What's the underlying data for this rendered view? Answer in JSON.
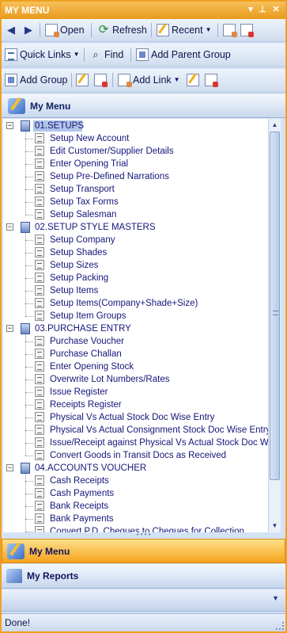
{
  "window": {
    "title": "MY MENU"
  },
  "toolbar1": {
    "open_label": "Open",
    "refresh_label": "Refresh",
    "recent_label": "Recent"
  },
  "toolbar2": {
    "quick_links_label": "Quick Links",
    "find_label": "Find",
    "add_parent_group_label": "Add Parent Group"
  },
  "toolbar3": {
    "add_group_label": "Add Group",
    "add_link_label": "Add Link"
  },
  "panel": {
    "title": "My Menu"
  },
  "tree": [
    {
      "label": "01.SETUPS",
      "items": [
        "Setup New Account",
        "Edit Customer/Supplier Details",
        "Enter Opening Trial",
        "Setup Pre-Defined Narrations",
        "Setup Transport",
        "Setup Tax Forms",
        "Setup Salesman"
      ]
    },
    {
      "label": "02.SETUP STYLE MASTERS",
      "items": [
        "Setup Company",
        "Setup Shades",
        "Setup Sizes",
        "Setup Packing",
        "Setup Items",
        "Setup Items(Company+Shade+Size)",
        "Setup Item Groups"
      ]
    },
    {
      "label": "03.PURCHASE ENTRY",
      "items": [
        "Purchase Voucher",
        "Purchase Challan",
        "Enter Opening Stock",
        "Overwrite Lot Numbers/Rates",
        "Issue Register",
        "Receipts Register",
        "Physical Vs Actual Stock Doc Wise Entry",
        "Physical Vs Actual Consignment Stock Doc Wise Entry",
        "Issue/Receipt against Physical Vs Actual Stock Doc Wise",
        "Convert Goods in Transit Docs as Received"
      ]
    },
    {
      "label": "04.ACCOUNTS VOUCHER",
      "items": [
        "Cash Receipts",
        "Cash Payments",
        "Bank Receipts",
        "Bank Payments",
        "Convert P.D. Cheques to Cheques for Collection"
      ]
    }
  ],
  "nav": {
    "my_menu_label": "My Menu",
    "my_reports_label": "My Reports"
  },
  "status": {
    "text": "Done!"
  },
  "colors": {
    "accent": "#f0a020",
    "selection": "#b0c4e8",
    "text": "#15157a"
  }
}
